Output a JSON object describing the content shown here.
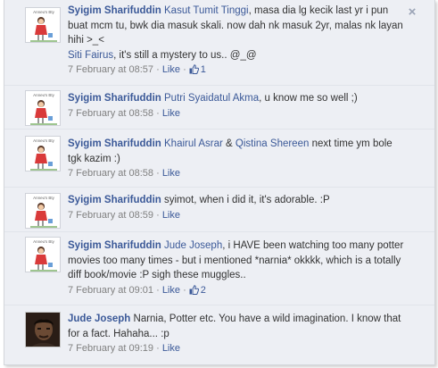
{
  "comments": [
    {
      "author": "Syigim Sharifuddin",
      "mention": "Kasut Tumit Tinggi",
      "text_a": ", masa dia lg kecik last yr i pun buat mcm tu, bwk dia masuk skali. now dah nk masuk 2yr, malas nk layan hihi >_<",
      "mention_2": "Siti Fairus",
      "text_b": ", it's still a mystery to us.. @_@",
      "date": "7 February at 08:57",
      "sep": "·",
      "like": "Like",
      "like_count": "1",
      "avatar": "doll-avatar-icon",
      "avatar_label": "Anneu's Bty"
    },
    {
      "author": "Syigim Sharifuddin",
      "mention": "Putri Syaidatul Akma",
      "text": ", u know me so well ;)",
      "date": "7 February at 08:58",
      "sep": "·",
      "like": "Like",
      "avatar": "doll-avatar-icon",
      "avatar_label": "Anneu's Bty"
    },
    {
      "author": "Syigim Sharifuddin",
      "mention": "Khairul Asrar",
      "amp": " & ",
      "mention_2": "Qistina Shereen",
      "text": " next time ym bole tgk kazim :)",
      "date": "7 February at 08:58",
      "sep": "·",
      "like": "Like",
      "avatar": "doll-avatar-icon",
      "avatar_label": "Anneu's Bty"
    },
    {
      "author": "Syigim Sharifuddin",
      "text": " syimot, when i did it, it's adorable. :P",
      "date": "7 February at 08:59",
      "sep": "·",
      "like": "Like",
      "avatar": "doll-avatar-icon",
      "avatar_label": "Anneu's Bty"
    },
    {
      "author": "Syigim Sharifuddin",
      "mention": "Jude Joseph",
      "text": ", i HAVE been watching too many potter movies too many times - but i mentioned *narnia* okkkk, which is a totally diff book/movie :P sigh these muggles..",
      "date": "7 February at 09:01",
      "sep": "·",
      "like": "Like",
      "like_count": "2",
      "avatar": "doll-avatar-icon",
      "avatar_label": "Anneu's Bty"
    },
    {
      "author": "Jude Joseph",
      "text": " Narnia, Potter etc. You have a wild imagination. I know that for a fact. Hahaha... :p",
      "date": "7 February at 09:19",
      "sep": "·",
      "like": "Like",
      "avatar": "person-photo-avatar"
    }
  ],
  "close_icon": "×",
  "colors": {
    "link": "#3b5998",
    "background": "#edeff4",
    "meta": "#808080"
  }
}
